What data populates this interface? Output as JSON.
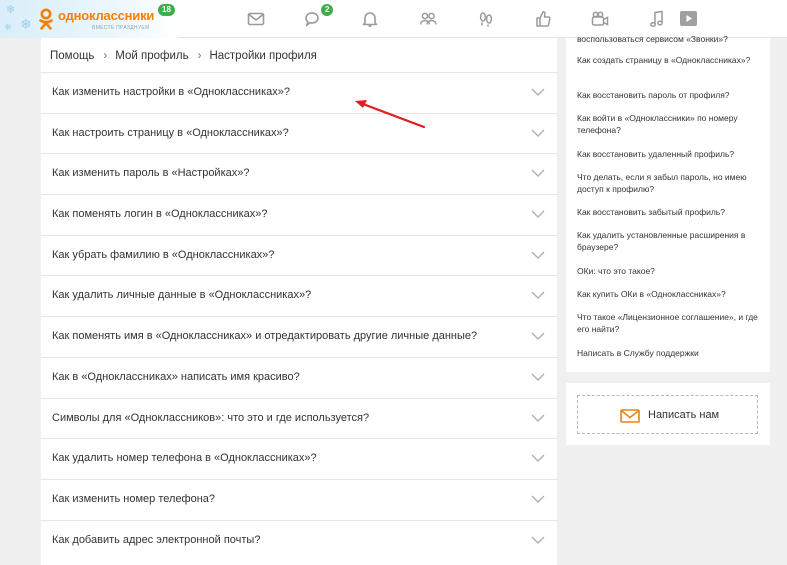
{
  "header": {
    "logo_text": "одноклассники",
    "logo_sub": "ВМЕСТЕ ПРАЗДНУЕМ",
    "logo_badge": "18",
    "messages_badge": "2",
    "nav_icons": [
      "mail-icon",
      "discussions-icon",
      "notifications-icon",
      "friends-icon",
      "guests-icon",
      "events-icon",
      "video-icon",
      "music-icon",
      "play-icon"
    ]
  },
  "breadcrumb": [
    "Помощь",
    "Мой профиль",
    "Настройки профиля"
  ],
  "faq": [
    "Как изменить настройки в «Одноклассниках»?",
    "Как настроить страницу в «Одноклассниках»?",
    "Как изменить пароль в «Настройках»?",
    "Как поменять логин в «Одноклассниках»?",
    "Как убрать фамилию в «Одноклассниках»?",
    "Как удалить личные данные в «Одноклассниках»?",
    "Как поменять имя в «Одноклассниках» и отредактировать другие личные данные?",
    "Как в «Одноклассниках» написать имя красиво?",
    "Символы для «Одноклассников»: что это и где используется?",
    "Как удалить номер телефона в «Одноклассниках»?",
    "Как изменить номер телефона?",
    "Как добавить адрес электронной почты?"
  ],
  "sidebar": {
    "links": [
      "воспользоваться сервисом «Звонки»?",
      "Как создать страницу в «Одноклассниках»?",
      "Как восстановить пароль от профиля?",
      "Как войти в «Одноклассники» по номеру телефона?",
      "Как восстановить удаленный профиль?",
      "Что делать, если я забыл пароль, но имею доступ к профилю?",
      "Как восстановить забытый профиль?",
      "Как удалить установленные расширения в браузере?",
      "ОКи: что это такое?",
      "Как купить ОКи в «Одноклассниках»?",
      "Что такое «Лицензионное соглашение», и где его найти?",
      "Написать в Службу поддержки"
    ],
    "write_button": "Написать нам"
  },
  "colors": {
    "brand_orange": "#ee8208",
    "badge_green": "#3fae49",
    "arrow_red": "#e02020"
  }
}
